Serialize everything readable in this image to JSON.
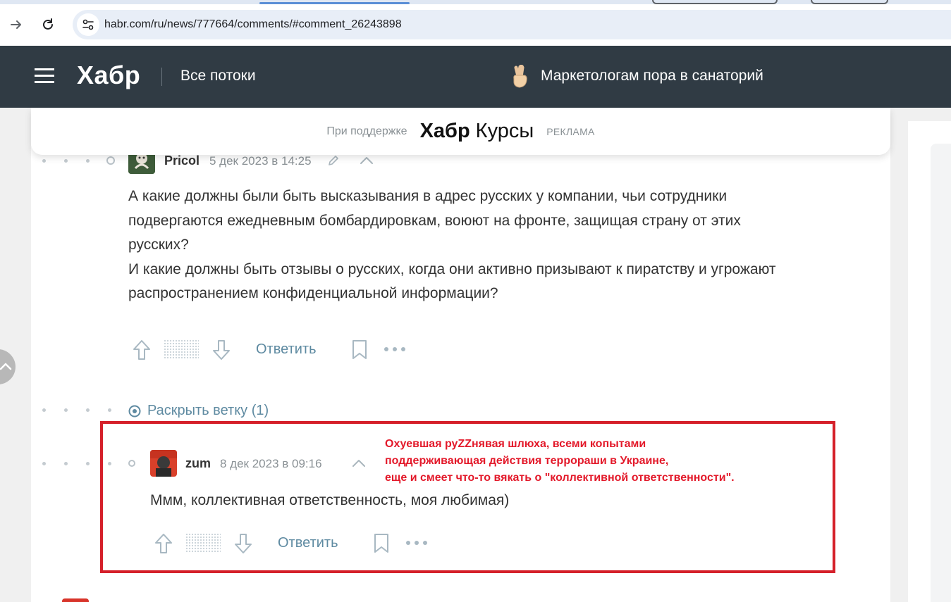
{
  "browser": {
    "url": "habr.com/ru/news/777664/comments/#comment_26243898"
  },
  "header": {
    "logo": "Хабр",
    "nav_label": "Все потоки",
    "promo_text": "Маркетологам пора в санаторий"
  },
  "sponsor": {
    "label": "При поддержке",
    "brand_bold": "Хабр",
    "brand_light": "Курсы",
    "ad_label": "РЕКЛАМА"
  },
  "comment1": {
    "author": "Pricol",
    "date": "5 дек 2023 в 14:25",
    "lines": [
      "А какие должны были быть высказывания в адрес русских у компании, чьи сотрудники",
      "подвергаются ежедневным бомбардировкам, воюют на фронте, защищая страну от этих",
      "русских?",
      "И какие должны быть отзывы о русских, когда они активно призывают к пиратству и угрожают",
      "распространением конфиденциальной информации?"
    ],
    "reply_label": "Ответить"
  },
  "thread": {
    "expand_label": "Раскрыть ветку (1)"
  },
  "comment2": {
    "author": "zum",
    "date": "8 дек 2023 в 09:16",
    "text": "Ммм, коллективная ответственность, моя любимая)",
    "reply_label": "Ответить"
  },
  "annotation": {
    "lines": [
      "Охуевшая руZZнявая шлюха, всеми копытами",
      "поддерживающая действия террораши в Украине,",
      "еще и смеет что-то вякать о \"коллективной ответственности\"."
    ],
    "color": "#e3192a"
  },
  "colors": {
    "header_bg": "#303b44",
    "link": "#5e8aa1",
    "highlight_border": "#d5202a"
  }
}
